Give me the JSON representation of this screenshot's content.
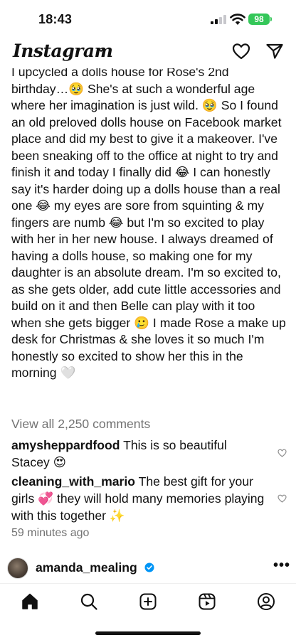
{
  "status": {
    "time": "18:43",
    "battery": "98"
  },
  "header": {
    "app_name": "Instagram"
  },
  "post": {
    "caption": "I upcycled a dolls house for Rose's 2nd birthday…🥹 She's at such a wonderful age where her imagination is just wild. 🥹 So I found an old preloved dolls house on Facebook market place and did my best to give it a makeover. I've been sneaking off to the office at night to try and finish it and today I finally did 😂 I can honestly say it's harder doing up a dolls house than a real one 😂 my eyes are sore from squinting & my fingers are numb 😂 but I'm so excited to play with her in her new house. I always dreamed of having a dolls house, so making one for my daughter is an absolute dream. I'm so excited to, as she gets older, add cute little accessories and build on it and then Belle can play with it too when she gets bigger 🥲 I made Rose a make up desk for Christmas & she loves it so much I'm honestly so excited to show her this in the morning 🤍",
    "view_all_comments": "View all 2,250 comments",
    "comments": [
      {
        "user": "amysheppardfood",
        "text": "This is so beautiful Stacey 😍"
      },
      {
        "user": "cleaning_with_mario",
        "text": "The best gift for your girls 💞 they will hold many memories playing with this together ✨"
      }
    ],
    "time_ago": "59 minutes ago"
  },
  "next_post": {
    "username": "amanda_mealing",
    "more": "•••"
  },
  "nav": {
    "items": [
      "home-icon",
      "search-icon",
      "create-icon",
      "reels-icon",
      "profile-icon"
    ]
  },
  "colors": {
    "battery": "#34c759",
    "verified": "#0095f6",
    "muted_text": "#737373"
  }
}
